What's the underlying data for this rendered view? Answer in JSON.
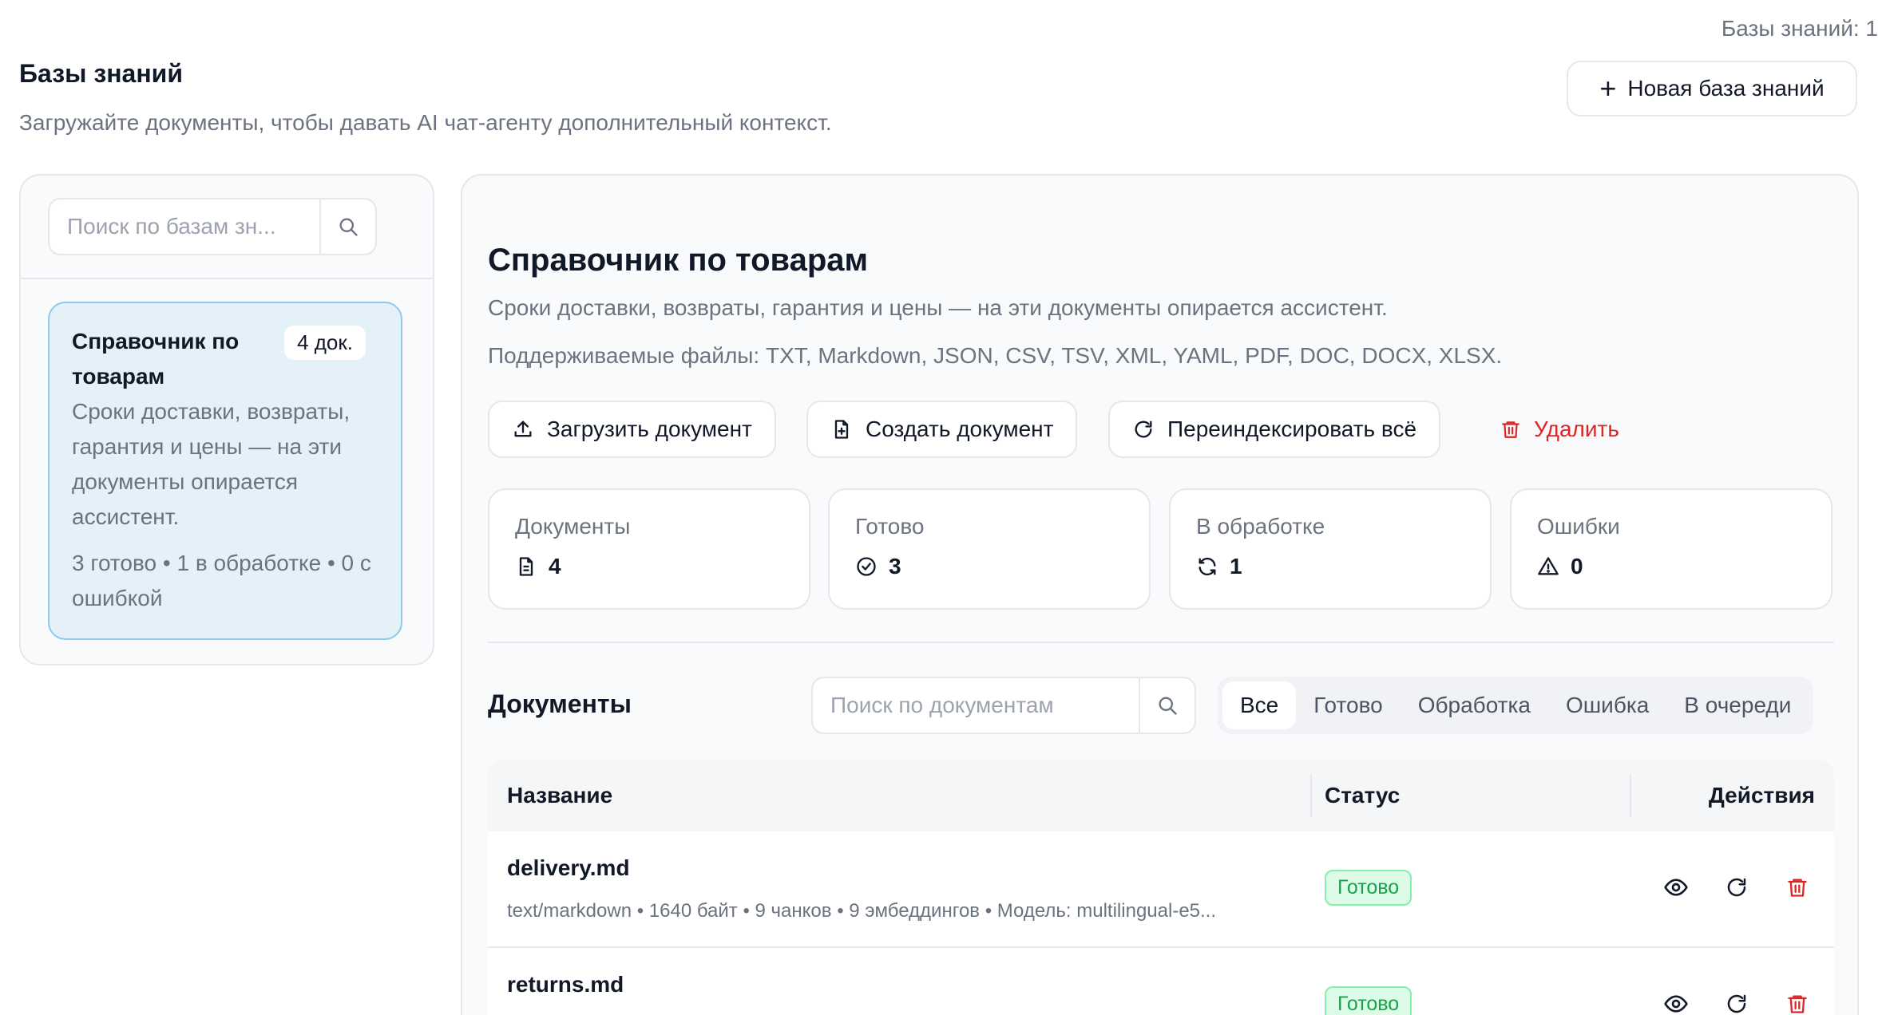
{
  "header": {
    "kb_count": "Базы знаний: 1",
    "title": "Базы знаний",
    "subtitle": "Загружайте документы, чтобы давать AI чат-агенту дополнительный контекст.",
    "new_kb_label": "Новая база знаний"
  },
  "sidebar": {
    "search_placeholder": "Поиск по базам зн...",
    "items": [
      {
        "name": "Справочник по товарам",
        "badge": "4 док.",
        "description": "Сроки доставки, возвраты, гарантия и цены — на эти документы опирается ассистент.",
        "stats": "3 готово • 1 в обработке • 0 с ошибкой"
      }
    ]
  },
  "main": {
    "title": "Справочник по товарам",
    "description": "Сроки доставки, возвраты, гарантия и цены — на эти документы опирается ассистент.",
    "formats": "Поддерживаемые файлы: TXT, Markdown, JSON, CSV, TSV, XML, YAML, PDF, DOC, DOCX, XLSX.",
    "actions": {
      "upload": "Загрузить документ",
      "create": "Создать документ",
      "reindex": "Переиндексировать всё",
      "delete": "Удалить"
    },
    "stats": [
      {
        "label": "Документы",
        "value": "4",
        "icon": "file-icon"
      },
      {
        "label": "Готово",
        "value": "3",
        "icon": "check-circle-icon"
      },
      {
        "label": "В обработке",
        "value": "1",
        "icon": "refresh-icon"
      },
      {
        "label": "Ошибки",
        "value": "0",
        "icon": "warning-icon"
      }
    ],
    "documents": {
      "title": "Документы",
      "search_placeholder": "Поиск по документам",
      "filters": [
        "Все",
        "Готово",
        "Обработка",
        "Ошибка",
        "В очереди"
      ],
      "active_filter": "Все",
      "columns": {
        "name": "Название",
        "status": "Статус",
        "actions": "Действия"
      },
      "rows": [
        {
          "name": "delivery.md",
          "meta": "text/markdown • 1640 байт • 9 чанков • 9 эмбеддингов • Модель: multilingual-e5...",
          "status": "Готово"
        },
        {
          "name": "returns.md",
          "meta": "",
          "status": "Готово"
        }
      ]
    }
  },
  "colors": {
    "accent_selected_bg": "#e4f1f8",
    "accent_selected_border": "#8ec9ea",
    "danger": "#dc2626",
    "success": "#16a34a"
  }
}
